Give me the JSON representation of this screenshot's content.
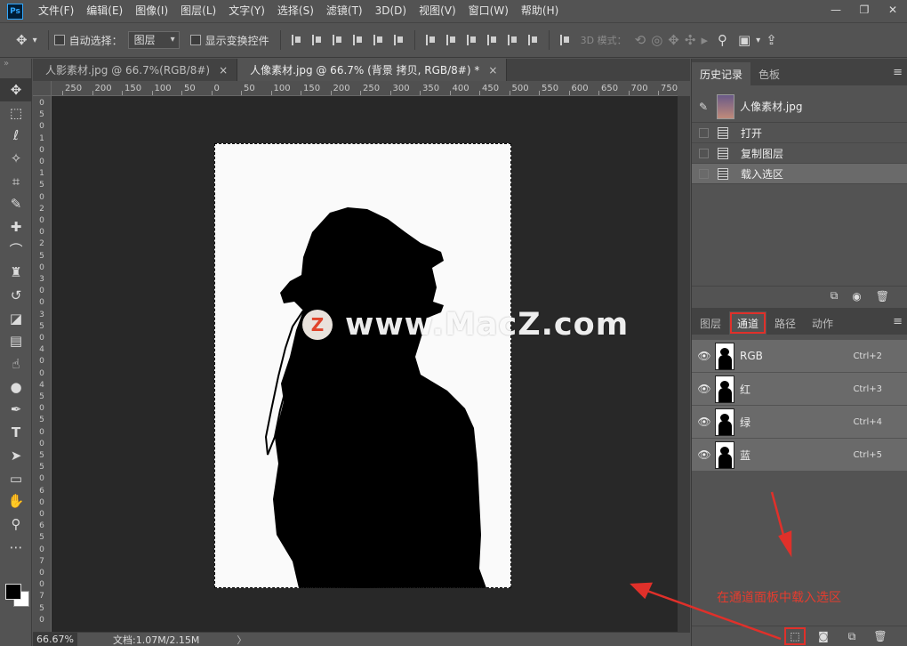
{
  "app": {
    "logo": "Ps"
  },
  "menu": [
    "文件(F)",
    "编辑(E)",
    "图像(I)",
    "图层(L)",
    "文字(Y)",
    "选择(S)",
    "滤镜(T)",
    "3D(D)",
    "视图(V)",
    "窗口(W)",
    "帮助(H)"
  ],
  "window_controls": [
    "—",
    "❐",
    "✕"
  ],
  "options": {
    "auto_select_label": "自动选择：",
    "auto_select_value": "图层",
    "show_transform_label": "显示变换控件",
    "mode_3d_label": "3D 模式："
  },
  "tabs": [
    {
      "label": "人影素材.jpg @ 66.7%(RGB/8#)",
      "close": "×",
      "active": false
    },
    {
      "label": "人像素材.jpg @ 66.7% (背景 拷贝, RGB/8#) *",
      "close": "×",
      "active": true
    }
  ],
  "ruler_h": [
    "250",
    "200",
    "150",
    "100",
    "50",
    "0",
    "50",
    "100",
    "150",
    "200",
    "250",
    "300",
    "350",
    "400",
    "450",
    "500",
    "550",
    "600",
    "650",
    "700",
    "750"
  ],
  "ruler_v": [
    "0",
    "5",
    "0",
    "1",
    "0",
    "0",
    "1",
    "5",
    "0",
    "2",
    "0",
    "0",
    "2",
    "5",
    "0",
    "3",
    "0",
    "0",
    "3",
    "5",
    "0",
    "4",
    "0",
    "0",
    "4",
    "5",
    "0",
    "5",
    "0",
    "0",
    "5",
    "5",
    "0",
    "6",
    "0",
    "0",
    "6",
    "5",
    "0",
    "7",
    "0",
    "0",
    "7",
    "5",
    "0"
  ],
  "watermark": {
    "logo": "Z",
    "text": "www.MacZ.com"
  },
  "status": {
    "zoom": "66.67%",
    "doc": "文档:1.07M/2.15M",
    "arrow": "〉"
  },
  "history": {
    "tabs": [
      {
        "label": "历史记录",
        "active": true
      },
      {
        "label": "色板",
        "active": false
      }
    ],
    "menu_icon": "≡",
    "snapshot_name": "人像素材.jpg",
    "items": [
      {
        "label": "打开"
      },
      {
        "label": "复制图层"
      },
      {
        "label": "载入选区"
      }
    ],
    "footer_icons": [
      "⧉",
      "◉",
      "🗑"
    ]
  },
  "channels": {
    "tabs": [
      {
        "label": "图层"
      },
      {
        "label": "通道"
      },
      {
        "label": "路径"
      },
      {
        "label": "动作"
      }
    ],
    "menu_icon": "≡",
    "rows": [
      {
        "name": "RGB",
        "key": "Ctrl+2"
      },
      {
        "name": "红",
        "key": "Ctrl+3"
      },
      {
        "name": "绿",
        "key": "Ctrl+4"
      },
      {
        "name": "蓝",
        "key": "Ctrl+5"
      }
    ],
    "eye": "👁",
    "annotation": "在通道面板中载入选区",
    "footer_icons": [
      "⬚",
      "◙",
      "⧉",
      "🗑"
    ]
  },
  "colors": {
    "accent_red": "#e0302a",
    "panel_bg": "#535353",
    "canvas_bg": "#282828"
  }
}
